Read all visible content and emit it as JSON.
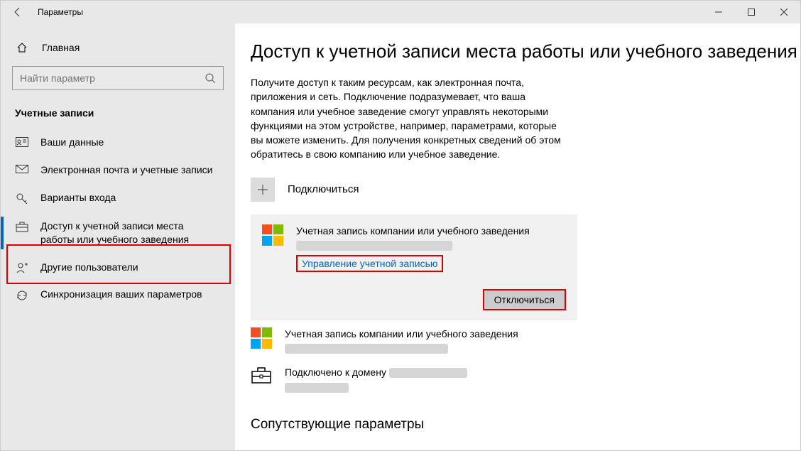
{
  "window": {
    "title": "Параметры"
  },
  "sidebar": {
    "home": "Главная",
    "search_placeholder": "Найти параметр",
    "group": "Учетные записи",
    "items": [
      {
        "label": "Ваши данные"
      },
      {
        "label": "Электронная почта и учетные записи"
      },
      {
        "label": "Варианты входа"
      },
      {
        "label": "Доступ к учетной записи места работы или учебного заведения"
      },
      {
        "label": "Другие пользователи"
      },
      {
        "label": "Синхронизация ваших параметров"
      }
    ]
  },
  "page": {
    "title": "Доступ к учетной записи места работы или учебного заведения",
    "description": "Получите доступ к таким ресурсам, как электронная почта, приложения и сеть. Подключение подразумевает, что ваша компания или учебное заведение смогут управлять некоторыми функциями на этом устройстве, например, параметрами, которые вы можете изменить. Для получения конкретных сведений об этом обратитесь в свою компанию или учебное заведение.",
    "connect_label": "Подключиться",
    "account1": {
      "heading": "Учетная запись компании или учебного заведения",
      "manage": "Управление учетной записью",
      "disconnect": "Отключиться"
    },
    "account2": {
      "heading": "Учетная запись компании или учебного заведения"
    },
    "domain": {
      "line": "Подключено к домену"
    },
    "related_title": "Сопутствующие параметры"
  }
}
